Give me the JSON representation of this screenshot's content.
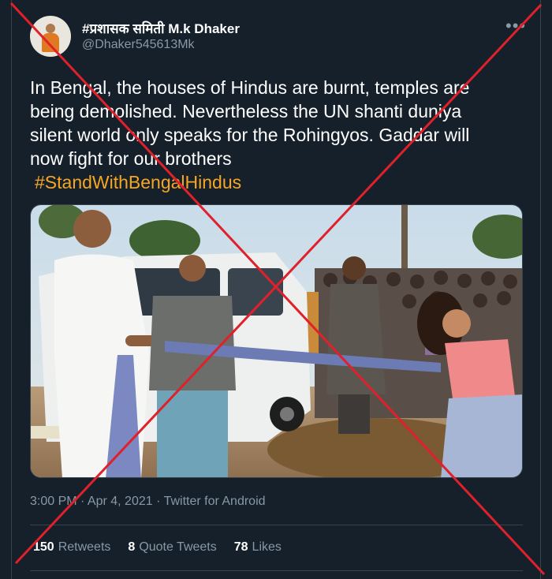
{
  "tweet": {
    "display_name": "#प्रशासक समिती M.k Dhaker",
    "handle": "@Dhaker545613Mk",
    "more_icon": "more-icon",
    "text_lines": [
      "In Bengal, the houses of Hindus are burnt, temples are",
      "being demolished. Nevertheless the UN shanti duniya",
      "silent world only speaks for the Rohingyos. Gaddar will",
      "now fight for our brothers"
    ],
    "hashtag": "#StandWithBengalHindus",
    "meta": "3:00 PM · Apr 4, 2021 · Twitter for Android",
    "stats": {
      "retweets_count": "150",
      "retweets_label": "Retweets",
      "quotes_count": "8",
      "quotes_label": "Quote Tweets",
      "likes_count": "78",
      "likes_label": "Likes"
    }
  },
  "colors": {
    "background": "#15202b",
    "secondary_text": "#8899a6",
    "hashtag": "#f5a623",
    "strike": "#e0202a"
  }
}
